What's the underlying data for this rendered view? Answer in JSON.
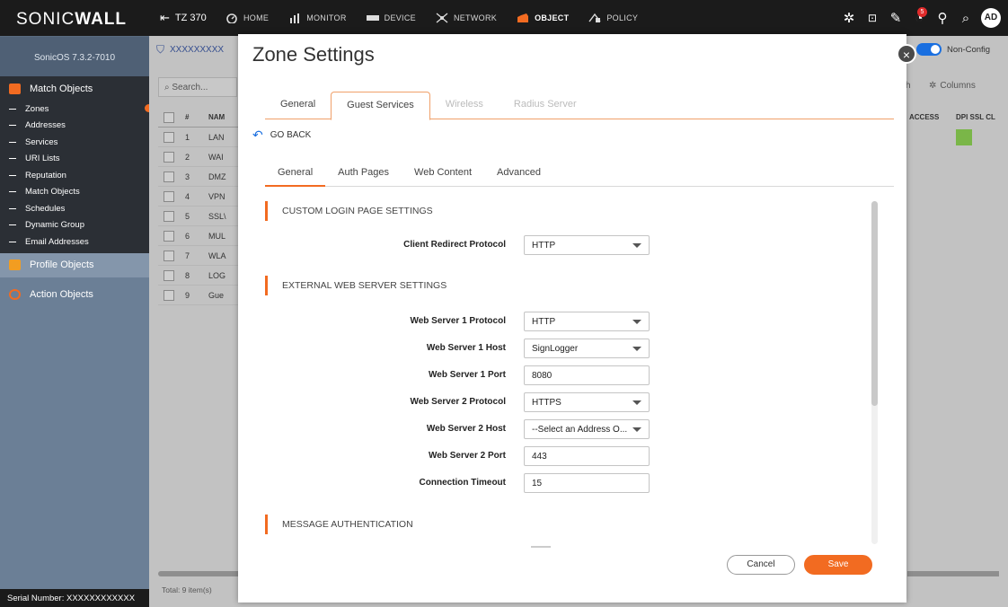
{
  "brand": {
    "name_light": "SONIC",
    "name_bold": "WALL",
    "version": "SonicOS 7.3.2-7010"
  },
  "device": {
    "label": "TZ 370"
  },
  "nav": [
    {
      "label": "HOME",
      "icon": "gauge-icon",
      "active": false
    },
    {
      "label": "MONITOR",
      "icon": "monitor-bars-icon",
      "active": false
    },
    {
      "label": "DEVICE",
      "icon": "device-icon",
      "active": false
    },
    {
      "label": "NETWORK",
      "icon": "network-icon",
      "active": false
    },
    {
      "label": "OBJECT",
      "icon": "object-icon",
      "active": true
    },
    {
      "label": "POLICY",
      "icon": "policy-icon",
      "active": false
    }
  ],
  "topright": {
    "notification_count": "5",
    "avatar": "AD"
  },
  "sidebar": {
    "sections": [
      {
        "label": "Match Objects",
        "color": "#f26b21"
      },
      {
        "label": "Profile Objects",
        "color": "#f29d21"
      },
      {
        "label": "Action Objects",
        "color": "#f26b21"
      }
    ],
    "items": [
      "Zones",
      "Addresses",
      "Services",
      "URI Lists",
      "Reputation",
      "Match Objects",
      "Schedules",
      "Dynamic Group",
      "Email Addresses"
    ],
    "serial": "Serial Number: XXXXXXXXXXXX"
  },
  "background": {
    "breadcrumb": "XXXXXXXXX",
    "search_placeholder": "Search...",
    "table_head": {
      "num": "#",
      "name": "NAM"
    },
    "rows": [
      {
        "num": "1",
        "name": "LAN"
      },
      {
        "num": "2",
        "name": "WAI"
      },
      {
        "num": "3",
        "name": "DMZ"
      },
      {
        "num": "4",
        "name": "VPN"
      },
      {
        "num": "5",
        "name": "SSL\\"
      },
      {
        "num": "6",
        "name": "MUL"
      },
      {
        "num": "7",
        "name": "WLA"
      },
      {
        "num": "8",
        "name": "LOG"
      },
      {
        "num": "9",
        "name": "Gue"
      }
    ],
    "right_cols": {
      "access": "ACCESS",
      "dpi": "DPI SSL CL"
    },
    "refresh_partial": "h",
    "columns_label": "Columns",
    "toggle_label": "Non-Config",
    "total": "Total: 9 item(s)"
  },
  "modal": {
    "title": "Zone Settings",
    "tabs": [
      {
        "label": "General",
        "state": "normal"
      },
      {
        "label": "Guest Services",
        "state": "active"
      },
      {
        "label": "Wireless",
        "state": "disabled"
      },
      {
        "label": "Radius Server",
        "state": "disabled"
      }
    ],
    "go_back": "GO BACK",
    "subtabs": [
      {
        "label": "General",
        "active": true
      },
      {
        "label": "Auth Pages",
        "active": false
      },
      {
        "label": "Web Content",
        "active": false
      },
      {
        "label": "Advanced",
        "active": false
      }
    ],
    "sections": {
      "custom_login": "CUSTOM LOGIN PAGE SETTINGS",
      "external_web": "EXTERNAL WEB SERVER SETTINGS",
      "message_auth": "MESSAGE AUTHENTICATION"
    },
    "fields": {
      "client_redirect": {
        "label": "Client Redirect Protocol",
        "value": "HTTP"
      },
      "ws1_protocol": {
        "label": "Web Server 1 Protocol",
        "value": "HTTP"
      },
      "ws1_host": {
        "label": "Web Server 1 Host",
        "value": "SignLogger"
      },
      "ws1_port": {
        "label": "Web Server 1 Port",
        "value": "8080"
      },
      "ws2_protocol": {
        "label": "Web Server 2 Protocol",
        "value": "HTTPS"
      },
      "ws2_host": {
        "label": "Web Server 2 Host",
        "value": "--Select an Address O..."
      },
      "ws2_port": {
        "label": "Web Server 2 Port",
        "value": "443"
      },
      "conn_timeout": {
        "label": "Connection Timeout",
        "value": "15"
      }
    },
    "buttons": {
      "cancel": "Cancel",
      "save": "Save"
    }
  }
}
